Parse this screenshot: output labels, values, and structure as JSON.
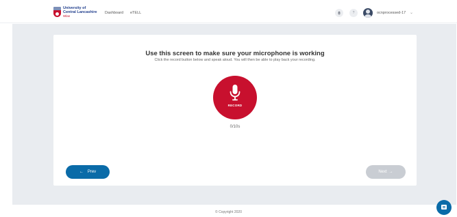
{
  "header": {
    "logo": {
      "line1": "University of",
      "line2": "Central Lancashire",
      "line3": "Wlan"
    },
    "nav": {
      "dashboard": "Dashboard",
      "etell": "eTELL"
    },
    "bell_icon": "bell-icon",
    "help_label": "?",
    "username": "ocnprocessed-17",
    "user_chevron": "⌄"
  },
  "main": {
    "title": "Use this screen to make sure your microphone is working",
    "subtitle": "Click the record button below and speak aloud. You will then be able to play back your recording.",
    "record_label": "RECORD",
    "timer": "0/10s",
    "prev": {
      "arrow": "←",
      "label": "Prev"
    },
    "next": {
      "label": "Next",
      "arrow": "→"
    }
  },
  "footer": {
    "copyright": "© Copyright 2020"
  },
  "colors": {
    "primary": "#0a6ba8",
    "record": "#c8102e",
    "disabled": "#c9cdd3",
    "background": "#e9ecf0"
  },
  "icons": {
    "mic": "microphone-icon",
    "chat": "chat-icon"
  }
}
